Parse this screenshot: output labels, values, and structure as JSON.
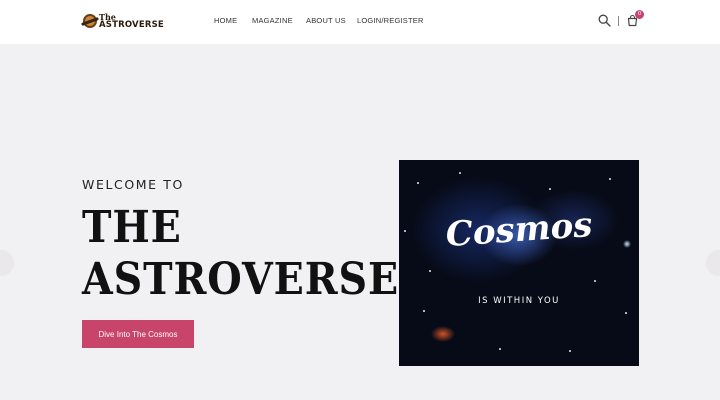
{
  "header": {
    "logo": {
      "line1": "The",
      "line2": "ASTROVERSE"
    },
    "nav": [
      {
        "label": "HOME"
      },
      {
        "label": "MAGAZINE"
      },
      {
        "label": "ABOUT US"
      },
      {
        "label": "LOGIN/REGISTER"
      }
    ],
    "cart_count": "0"
  },
  "hero": {
    "intro": "WELCOME TO",
    "title_line1": "THE",
    "title_line2": "ASTROVERSE",
    "cta_label": "Dive Into The Cosmos",
    "accent_color": "#c9446b"
  },
  "card": {
    "headline": "Cosmos",
    "subline": "IS WITHIN YOU"
  }
}
